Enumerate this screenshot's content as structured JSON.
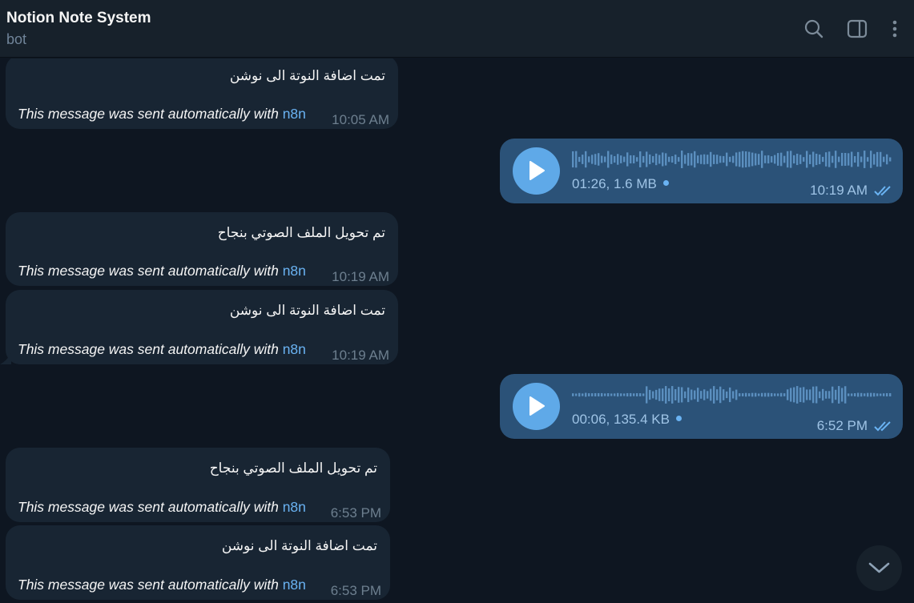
{
  "header": {
    "title": "Notion Note System",
    "subtitle": "bot"
  },
  "footer_text": "This message was sent automatically with ",
  "footer_link": "n8n",
  "messages": [
    {
      "type": "in",
      "text": "تمت اضافة النوتة الى نوشن",
      "time": "10:05 AM"
    },
    {
      "type": "voice",
      "meta": "01:26, 1.6 MB",
      "time": "10:19 AM"
    },
    {
      "type": "in",
      "text": "تم تحويل الملف الصوتي بنجاح",
      "time": "10:19 AM"
    },
    {
      "type": "in",
      "text": "تمت اضافة النوتة الى نوشن",
      "time": "10:19 AM"
    },
    {
      "type": "voice",
      "meta": "00:06, 135.4 KB",
      "time": "6:52 PM"
    },
    {
      "type": "in",
      "text": "تم تحويل الملف الصوتي بنجاح",
      "time": "6:53 PM"
    },
    {
      "type": "in",
      "text": "تمت اضافة النوتة الى نوشن",
      "time": "6:53 PM"
    }
  ],
  "icons": {
    "search": "search-icon",
    "sidebar": "sidebar-toggle-icon",
    "menu": "more-vertical-icon",
    "play": "play-icon",
    "read": "double-check-icon",
    "scroll": "chevron-down-icon"
  },
  "colors": {
    "background": "#0e1621",
    "header": "#17212b",
    "incoming": "#182533",
    "outgoing": "#2b5278",
    "accent": "#6ab3f3",
    "play": "#5fa9e8"
  }
}
